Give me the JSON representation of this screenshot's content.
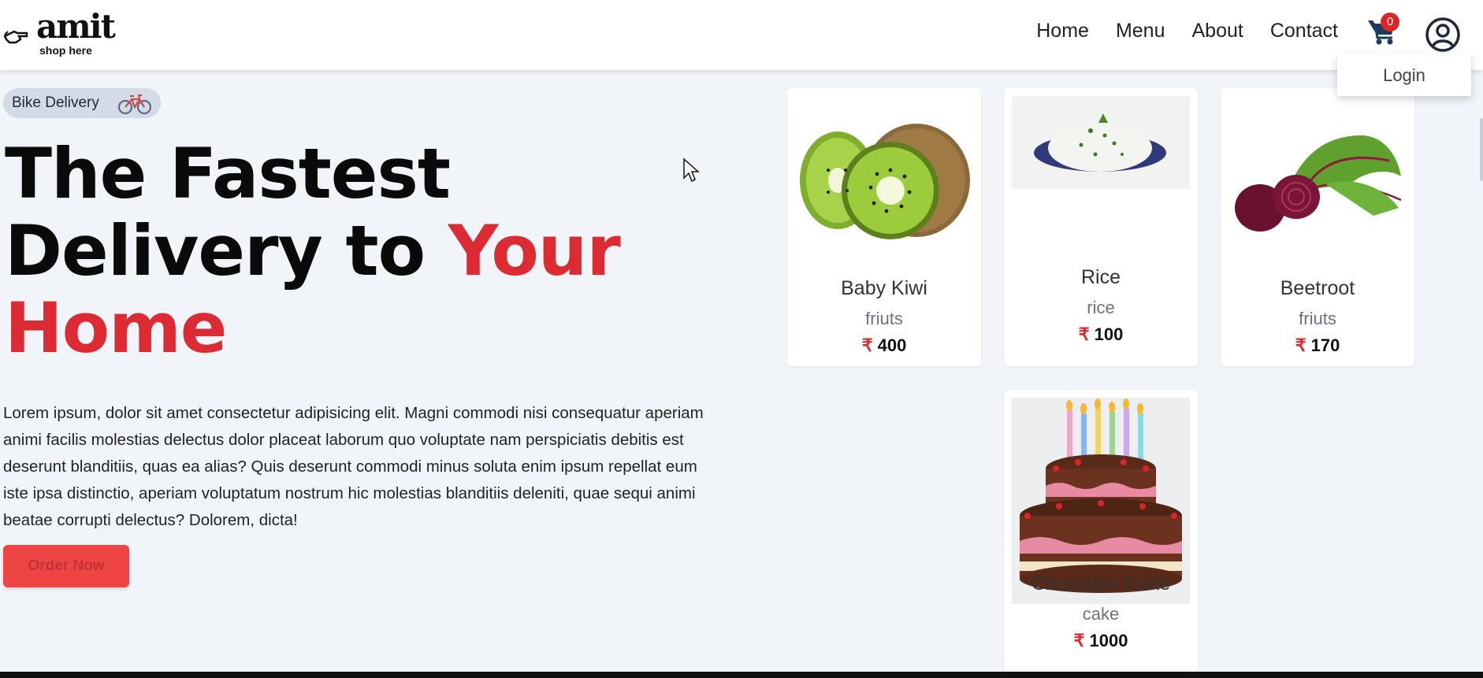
{
  "brand": {
    "name": "amit",
    "tagline": "shop here"
  },
  "nav": {
    "items": [
      "Home",
      "Menu",
      "About",
      "Contact"
    ]
  },
  "cart": {
    "count": "0"
  },
  "account": {
    "menu_item": "Login"
  },
  "hero": {
    "badge": "Bike Delivery",
    "title_part1": "The Fastest",
    "title_part2": "Delivery to ",
    "title_accent1": "Your",
    "title_accent2": "Home",
    "text": "Lorem ipsum, dolor sit amet consectetur adipisicing elit. Magni commodi nisi consequatur aperiam animi facilis molestias delectus dolor placeat laborum quo voluptate nam perspiciatis debitis est deserunt blanditiis, quas ea alias? Quis deserunt commodi minus soluta enim ipsum repellat eum iste ipsa distinctio, aperiam voluptatum nostrum hic molestias blanditiis deleniti, quae sequi animi beatae corrupti delectus? Dolorem, dicta!",
    "button": "Order Now"
  },
  "currency": "₹",
  "products": [
    {
      "name": "Baby Kiwi",
      "category": "friuts",
      "price": "400",
      "icon": "kiwi-image"
    },
    {
      "name": "Rice",
      "category": "rice",
      "price": "100",
      "icon": "rice-image"
    },
    {
      "name": "Beetroot",
      "category": "friuts",
      "price": "170",
      "icon": "beetroot-image"
    },
    {
      "name": "Chocklate Cake",
      "category": "cake",
      "price": "1000",
      "icon": "cake-image"
    }
  ],
  "colors": {
    "accent": "#dc2b32",
    "cart": "#1f3a5f",
    "badge_bg": "#d3dbe6",
    "page_bg": "#f1f4f8"
  }
}
